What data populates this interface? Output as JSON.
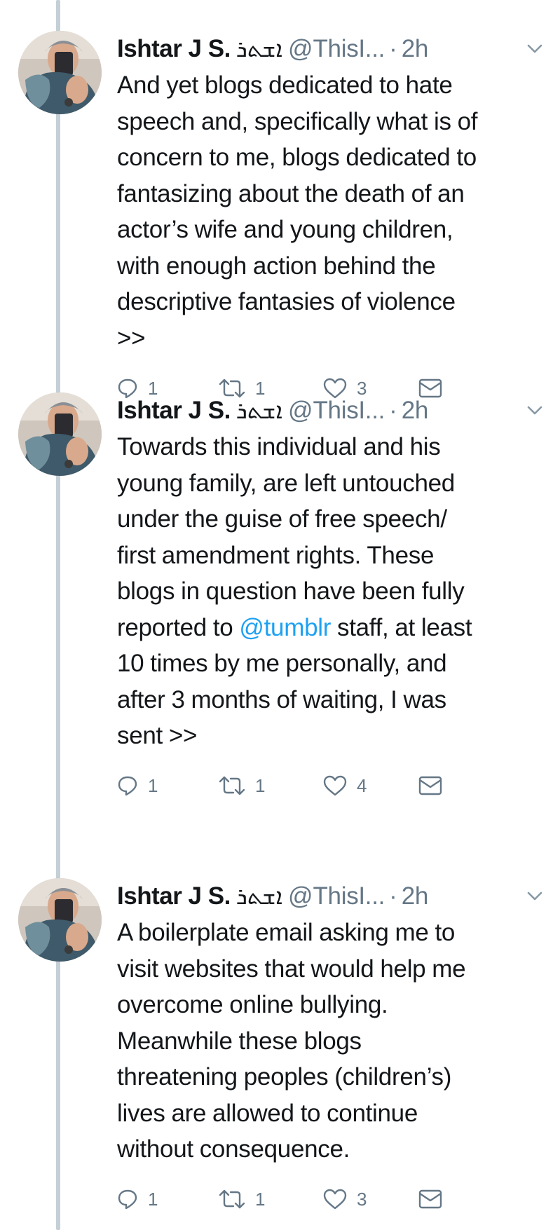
{
  "colors": {
    "text": "#14171a",
    "secondary": "#657786",
    "link": "#1da1f2",
    "thread_line": "#c4cfd6"
  },
  "tweets": [
    {
      "author": {
        "name": "Ishtar J S.",
        "script_name": "ܐܫܬܪ",
        "handle": "@ThisI...",
        "separator": "·",
        "time": "2h"
      },
      "lines": [
        "And yet blogs dedicated to hate",
        "speech and, specifically what is of",
        "concern to me, blogs dedicated to",
        "fantasizing about the death of an",
        "actor’s wife and young children,",
        "with enough action behind the",
        "descriptive fantasies of violence",
        ">>"
      ],
      "replies": "1",
      "retweets": "1",
      "likes": "3",
      "icons": [
        "reply-icon",
        "retweet-icon",
        "heart-icon",
        "envelope-icon",
        "chevron-down-icon"
      ]
    },
    {
      "author": {
        "name": "Ishtar J S.",
        "script_name": "ܐܫܬܪ",
        "handle": "@ThisI...",
        "separator": "·",
        "time": "2h"
      },
      "lines": [
        "Towards this individual and his",
        "young family, are left untouched",
        "under the guise of free speech/",
        "first amendment rights. These",
        "blogs in question have been fully"
      ],
      "mention_line": {
        "before": "reported to ",
        "mention": "@tumblr",
        "after": " staff, at least"
      },
      "lines_after": [
        "10 times by me personally, and",
        "after 3 months of waiting, I was",
        "sent >>"
      ],
      "replies": "1",
      "retweets": "1",
      "likes": "4"
    },
    {
      "author": {
        "name": "Ishtar J S.",
        "script_name": "ܐܫܬܪ",
        "handle": "@ThisI...",
        "separator": "·",
        "time": "2h"
      },
      "lines": [
        "A boilerplate email asking me to",
        "visit websites that would help me",
        "overcome online bullying.",
        "Meanwhile these blogs",
        "threatening peoples (children’s)",
        "lives are allowed to continue",
        "without consequence."
      ],
      "replies": "1",
      "retweets": "1",
      "likes": "3"
    }
  ]
}
